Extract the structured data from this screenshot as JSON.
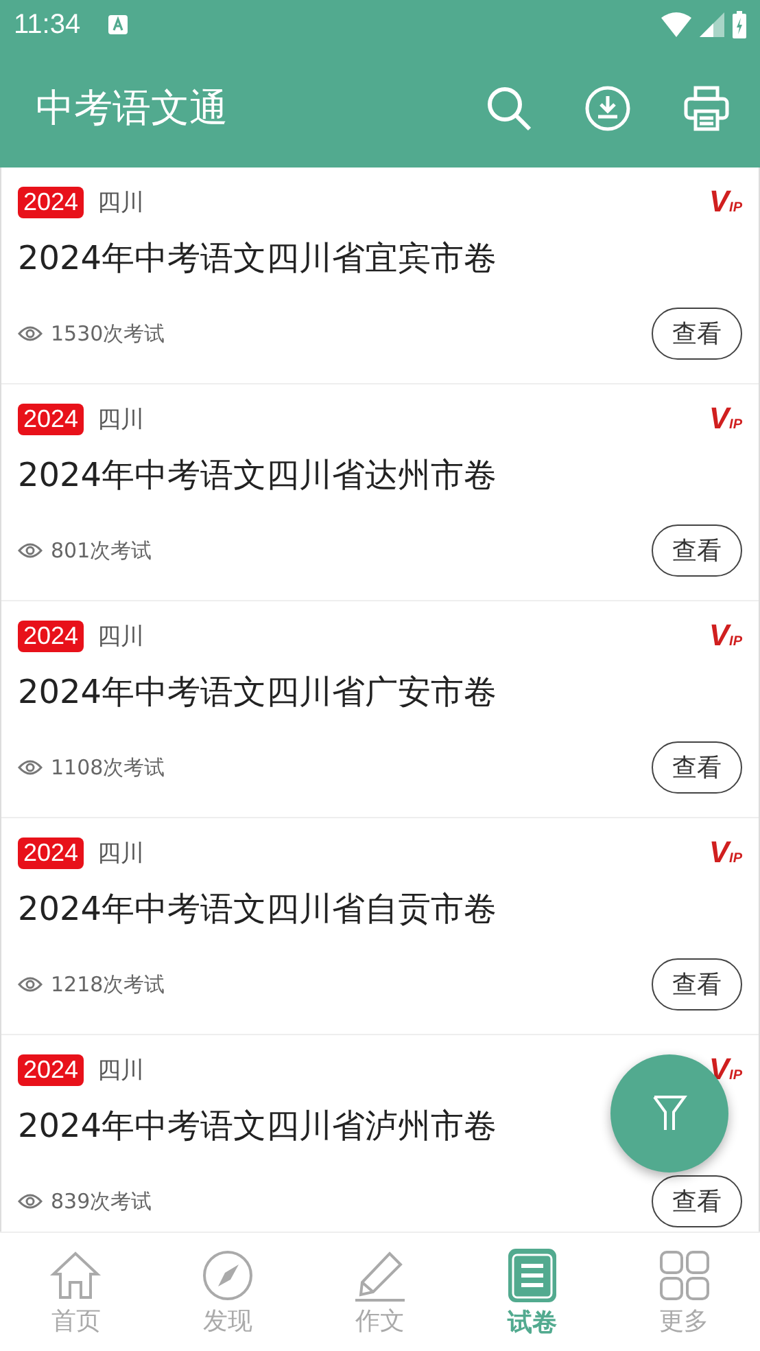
{
  "status_bar": {
    "time": "11:34"
  },
  "app_bar": {
    "title": "中考语文通"
  },
  "papers": [
    {
      "year": "2024",
      "region": "四川",
      "vip": {
        "main": "V",
        "sub": "IP"
      },
      "title": "2024年中考语文四川省宜宾市卷",
      "views": "1530次考试",
      "button": "查看"
    },
    {
      "year": "2024",
      "region": "四川",
      "vip": {
        "main": "V",
        "sub": "IP"
      },
      "title": "2024年中考语文四川省达州市卷",
      "views": "801次考试",
      "button": "查看"
    },
    {
      "year": "2024",
      "region": "四川",
      "vip": {
        "main": "V",
        "sub": "IP"
      },
      "title": "2024年中考语文四川省广安市卷",
      "views": "1108次考试",
      "button": "查看"
    },
    {
      "year": "2024",
      "region": "四川",
      "vip": {
        "main": "V",
        "sub": "IP"
      },
      "title": "2024年中考语文四川省自贡市卷",
      "views": "1218次考试",
      "button": "查看"
    },
    {
      "year": "2024",
      "region": "四川",
      "vip": {
        "main": "V",
        "sub": "IP"
      },
      "title": "2024年中考语文四川省泸州市卷",
      "views": "839次考试",
      "button": "查看"
    }
  ],
  "bottom_nav": [
    {
      "kind": "home",
      "label": "首页",
      "selected": false
    },
    {
      "kind": "discover",
      "label": "发现",
      "selected": false
    },
    {
      "kind": "essay",
      "label": "作文",
      "selected": false
    },
    {
      "kind": "papers",
      "label": "试卷",
      "selected": true
    },
    {
      "kind": "more",
      "label": "更多",
      "selected": false
    }
  ]
}
